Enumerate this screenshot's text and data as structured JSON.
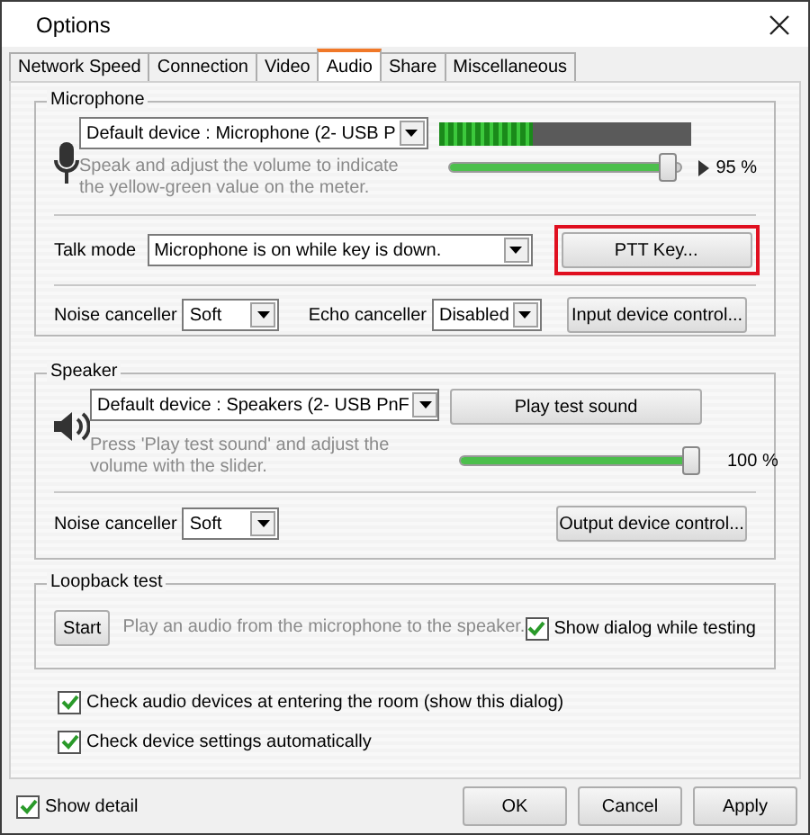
{
  "window": {
    "title": "Options"
  },
  "tabs": [
    {
      "label": "Network Speed",
      "selected": false
    },
    {
      "label": "Connection",
      "selected": false
    },
    {
      "label": "Video",
      "selected": false
    },
    {
      "label": "Audio",
      "selected": true
    },
    {
      "label": "Share",
      "selected": false
    },
    {
      "label": "Miscellaneous",
      "selected": false
    }
  ],
  "microphone": {
    "title": "Microphone",
    "device": "Default device : Microphone (2- USB P",
    "hint": "Speak and adjust the volume to indicate the yellow-green value on the meter.",
    "meter": {
      "level": 0.37
    },
    "volume": {
      "level": 0.95,
      "reading": "95 %"
    },
    "talk_mode_label": "Talk mode",
    "talk_mode": "Microphone is on while key is down.",
    "ptt_button": {
      "label": "PTT Key...",
      "highlighted": true
    },
    "noise_label": "Noise canceller",
    "noise": "Soft",
    "echo_label": "Echo canceller",
    "echo": "Disabled",
    "device_button": "Input device control..."
  },
  "speaker": {
    "title": "Speaker",
    "device": "Default device : Speakers (2- USB PnF",
    "play_button": "Play test sound",
    "hint": "Press 'Play test sound' and adjust the volume with the slider.",
    "volume": {
      "level": 1.0,
      "reading": "100 %"
    },
    "noise_label": "Noise canceller",
    "noise": "Soft",
    "device_button": "Output device control..."
  },
  "loopback": {
    "title": "Loopback test",
    "start_button": "Start",
    "description": "Play an audio from the microphone to the speaker.",
    "show_dialog": {
      "label": "Show dialog while testing",
      "checked": true
    }
  },
  "options": [
    {
      "label": "Check audio devices at entering the room (show this dialog)",
      "checked": true
    },
    {
      "label": "Check device settings automatically",
      "checked": true
    }
  ],
  "show_detail": {
    "label": "Show detail",
    "checked": true
  },
  "buttons": [
    "OK",
    "Cancel",
    "Apply"
  ]
}
